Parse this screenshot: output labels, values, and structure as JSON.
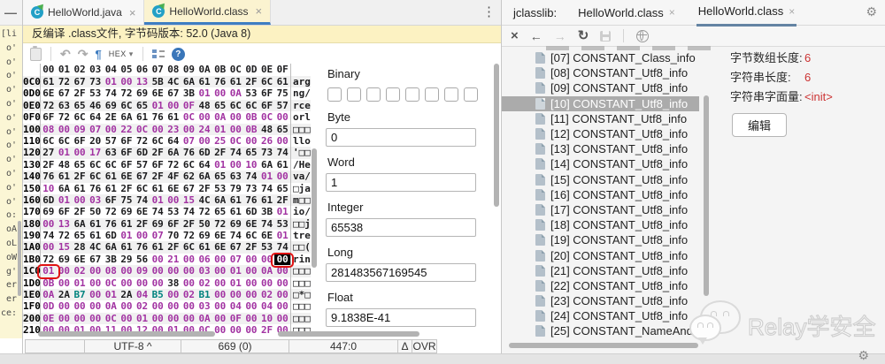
{
  "left_strip": {
    "fragments": [
      "[li",
      "o'",
      "o'",
      "o'",
      "o'",
      "o'",
      "o'",
      "o'",
      "o'",
      "o'",
      "o'",
      "o'",
      "o'",
      "o:",
      "oA",
      "oL",
      "oW",
      "g'",
      "er",
      "er",
      "ce:"
    ]
  },
  "window": {
    "tabs": [
      {
        "label": "HelloWorld.java",
        "icon": "C"
      },
      {
        "label": "HelloWorld.class",
        "icon": "C"
      }
    ],
    "banner": "反编译 .class文件, 字节码版本: 52.0 (Java 8)",
    "toolbar": {
      "hex_dropdown": "HEX"
    },
    "hex": {
      "col_headers": "00 01 02 03 04 05 06 07 08 09 0A 0B 0C 0D 0E 0F",
      "rows": [
        {
          "addr": "0C0",
          "bytes": "61 72 67 73 01 00 13 5B 4C 6A 61 76 61 2F 6C 61",
          "colors": "kkkkpppkkkkkkkkk",
          "ascii": "arg"
        },
        {
          "addr": "0D0",
          "bytes": "6E 67 2F 53 74 72 69 6E 67 3B 01 00 0A 53 6F 75",
          "colors": "kkkkkkkkkkpppkkk",
          "ascii": "ng/"
        },
        {
          "addr": "0E0",
          "bytes": "72 63 65 46 69 6C 65 01 00 0F 48 65 6C 6C 6F 57",
          "colors": "kkkkkkkpppkkkkkk",
          "ascii": "rce"
        },
        {
          "addr": "0F0",
          "bytes": "6F 72 6C 64 2E 6A 61 76 61 0C 00 0A 00 0B 0C 00",
          "colors": "kkkkkkkkkppppppp",
          "ascii": "orl"
        },
        {
          "addr": "100",
          "bytes": "08 00 09 07 00 22 0C 00 23 00 24 01 00 0B 48 65",
          "colors": "ppppppppppppppkk",
          "ascii": "□□□"
        },
        {
          "addr": "110",
          "bytes": "6C 6C 6F 20 57 6F 72 6C 64 07 00 25 0C 00 26 00",
          "colors": "kkkkkkkkkppppppp",
          "ascii": "llo"
        },
        {
          "addr": "120",
          "bytes": "27 01 00 17 63 6F 6D 2F 6A 76 6D 2F 74 65 73 74",
          "colors": "kpppkkkkkkkkkkkk",
          "ascii": "'□□"
        },
        {
          "addr": "130",
          "bytes": "2F 48 65 6C 6C 6F 57 6F 72 6C 64 01 00 10 6A 61",
          "colors": "kkkkkkkkkkkpppkk",
          "ascii": "/He"
        },
        {
          "addr": "140",
          "bytes": "76 61 2F 6C 61 6E 67 2F 4F 62 6A 65 63 74 01 00",
          "colors": "kkkkkkkkkkkkkkpp",
          "ascii": "va/"
        },
        {
          "addr": "150",
          "bytes": "10 6A 61 76 61 2F 6C 61 6E 67 2F 53 79 73 74 65",
          "colors": "pkkkkkkkkkkkkkkk",
          "ascii": "□ja"
        },
        {
          "addr": "160",
          "bytes": "6D 01 00 03 6F 75 74 01 00 15 4C 6A 61 76 61 2F",
          "colors": "kpppkkkpppkkkkkk",
          "ascii": "m□□"
        },
        {
          "addr": "170",
          "bytes": "69 6F 2F 50 72 69 6E 74 53 74 72 65 61 6D 3B 01",
          "colors": "kkkkkkkkkkkkkkkp",
          "ascii": "io/"
        },
        {
          "addr": "180",
          "bytes": "00 13 6A 61 76 61 2F 69 6F 2F 50 72 69 6E 74 53",
          "colors": "ppkkkkkkkkkkkkkk",
          "ascii": "□□j"
        },
        {
          "addr": "190",
          "bytes": "74 72 65 61 6D 01 00 07 70 72 69 6E 74 6C 6E 01",
          "colors": "kkkkkpppkkkkkkkp",
          "ascii": "tre"
        },
        {
          "addr": "1A0",
          "bytes": "00 15 28 4C 6A 61 76 61 2F 6C 61 6E 67 2F 53 74",
          "colors": "ppkkkkkkkkkkkkkk",
          "ascii": "□□("
        },
        {
          "addr": "1B0",
          "bytes": "72 69 6E 67 3B 29 56 00 21 00 06 00 07 00 00 00",
          "colors": "kkkkkkkppppppppc",
          "ascii": "rin"
        },
        {
          "addr": "1C0",
          "bytes": "01 00 02 00 08 00 09 00 00 00 03 00 01 00 0A 00",
          "colors": "pppppppppppppppp",
          "ascii": "□□□"
        },
        {
          "addr": "1D0",
          "bytes": "0B 00 01 00 0C 00 00 00 38 00 02 00 01 00 00 00",
          "colors": "ppppppppkppppppp",
          "ascii": "□□□"
        },
        {
          "addr": "1E0",
          "bytes": "0A 2A B7 00 01 2A 04 B5 00 02 B1 00 00 00 02 00",
          "colors": "pktppkptpptppppp",
          "ascii": "□*□"
        },
        {
          "addr": "1F0",
          "bytes": "0D 00 00 00 0A 00 02 00 00 00 03 00 04 00 04 00",
          "colors": "pppppppppppppppp",
          "ascii": "□□□"
        },
        {
          "addr": "200",
          "bytes": "0E 00 00 00 0C 00 01 00 00 00 0A 00 0F 00 10 00",
          "colors": "pppppppppppppppp",
          "ascii": "□□□"
        },
        {
          "addr": "210",
          "bytes": "00 00 01 00 11 00 12 00 01 00 0C 00 00 00 2F 00",
          "colors": "pppppppppppppppp",
          "ascii": "□□□"
        }
      ],
      "red_boxes": [
        {
          "row": 15,
          "col": 15
        },
        {
          "row": 16,
          "col": 0
        }
      ]
    },
    "inspector": {
      "binary_label": "Binary",
      "binary_bits": 8,
      "fields": [
        {
          "label": "Byte",
          "value": "0"
        },
        {
          "label": "Word",
          "value": "1"
        },
        {
          "label": "Integer",
          "value": "65538"
        },
        {
          "label": "Long",
          "value": "281483567169545"
        },
        {
          "label": "Float",
          "value": "9.1838E-41"
        }
      ]
    },
    "status": {
      "encoding": "UTF-8 ^",
      "size": "669 (0)",
      "position": "447:0",
      "delta": "Δ",
      "mode": "OVR"
    }
  },
  "jclasslib": {
    "title": "jclasslib:",
    "tabs": [
      {
        "label": "HelloWorld.class"
      },
      {
        "label": "HelloWorld.class"
      }
    ],
    "tree": [
      {
        "index": "[07]",
        "label": "CONSTANT_Class_info"
      },
      {
        "index": "[08]",
        "label": "CONSTANT_Utf8_info"
      },
      {
        "index": "[09]",
        "label": "CONSTANT_Utf8_info"
      },
      {
        "index": "[10]",
        "label": "CONSTANT_Utf8_info",
        "selected": true
      },
      {
        "index": "[11]",
        "label": "CONSTANT_Utf8_info"
      },
      {
        "index": "[12]",
        "label": "CONSTANT_Utf8_info"
      },
      {
        "index": "[13]",
        "label": "CONSTANT_Utf8_info"
      },
      {
        "index": "[14]",
        "label": "CONSTANT_Utf8_info"
      },
      {
        "index": "[15]",
        "label": "CONSTANT_Utf8_info"
      },
      {
        "index": "[16]",
        "label": "CONSTANT_Utf8_info"
      },
      {
        "index": "[17]",
        "label": "CONSTANT_Utf8_info"
      },
      {
        "index": "[18]",
        "label": "CONSTANT_Utf8_info"
      },
      {
        "index": "[19]",
        "label": "CONSTANT_Utf8_info"
      },
      {
        "index": "[20]",
        "label": "CONSTANT_Utf8_info"
      },
      {
        "index": "[21]",
        "label": "CONSTANT_Utf8_info"
      },
      {
        "index": "[22]",
        "label": "CONSTANT_Utf8_info"
      },
      {
        "index": "[23]",
        "label": "CONSTANT_Utf8_info"
      },
      {
        "index": "[24]",
        "label": "CONSTANT_Utf8_info"
      },
      {
        "index": "[25]",
        "label": "CONSTANT_NameAndType_info"
      }
    ],
    "detail": {
      "rows": [
        {
          "label": "字节数组长度:",
          "value": "6"
        },
        {
          "label": "字符串长度:",
          "value": "6"
        },
        {
          "label": "字符串字面量:",
          "value": "<init>"
        }
      ],
      "edit_button": "编辑"
    }
  },
  "watermark": "Relay学安全"
}
